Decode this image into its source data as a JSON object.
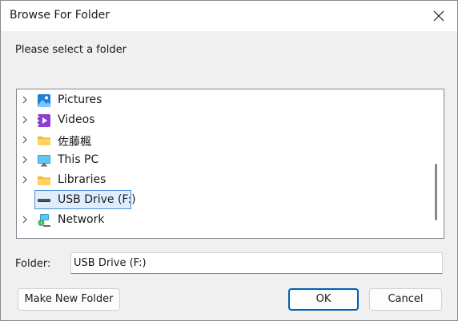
{
  "window": {
    "title": "Browse For Folder",
    "close_label": "Close"
  },
  "prompt": "Please select a folder",
  "tree": {
    "items": [
      {
        "label": "Pictures",
        "icon": "pictures-icon",
        "expandable": true
      },
      {
        "label": "Videos",
        "icon": "videos-icon",
        "expandable": true
      },
      {
        "label": "佐藤楓",
        "icon": "user-folder-icon",
        "expandable": true
      },
      {
        "label": "This PC",
        "icon": "monitor-icon",
        "expandable": true
      },
      {
        "label": "Libraries",
        "icon": "libraries-folder-icon",
        "expandable": true
      },
      {
        "label": "USB Drive (F:)",
        "icon": "usb-drive-icon",
        "expandable": false,
        "selected": true
      },
      {
        "label": "Network",
        "icon": "network-icon",
        "expandable": true
      }
    ]
  },
  "folder_field": {
    "label": "Folder:",
    "value": "USB Drive (F:)"
  },
  "buttons": {
    "make_new_folder": "Make New Folder",
    "ok": "OK",
    "cancel": "Cancel"
  },
  "colors": {
    "accent": "#005fb8",
    "selection_bg": "#dfeeff",
    "selection_border": "#4a8fd8",
    "dialog_bg": "#f0f0f0"
  }
}
